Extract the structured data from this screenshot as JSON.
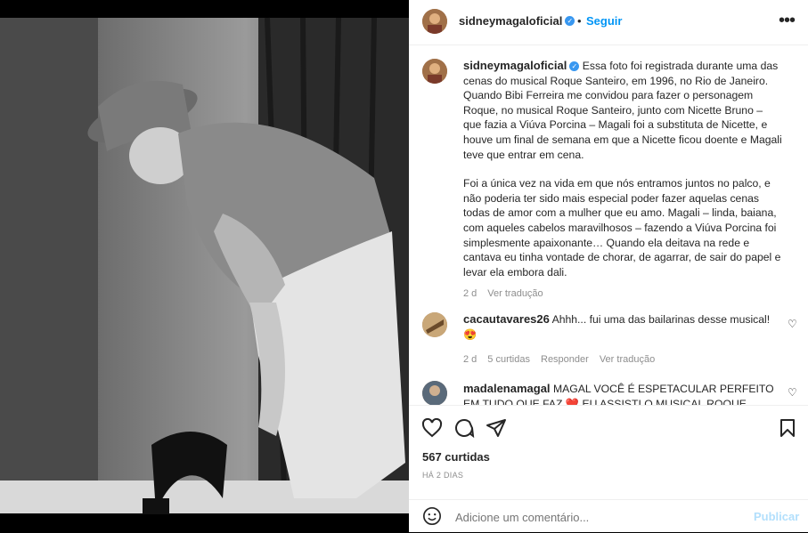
{
  "post": {
    "username": "sidneymagaloficial",
    "follow_label": "Seguir",
    "separator": "•"
  },
  "caption": {
    "username": "sidneymagaloficial",
    "paragraph1": "Essa foto foi registrada durante uma das cenas do musical Roque Santeiro, em 1996, no Rio de Janeiro. Quando Bibi Ferreira me convidou para fazer o personagem Roque, no musical Roque Santeiro, junto com Nicette Bruno – que fazia a Viúva Porcina – Magali foi a substituta de Nicette, e houve um final de semana em que a Nicette ficou doente e Magali teve que entrar em cena.",
    "paragraph2": "Foi a única vez na vida em que nós entramos juntos no palco, e não poderia ter sido mais especial poder fazer aquelas cenas todas de amor com a mulher que eu amo. Magali – linda, baiana, com aqueles cabelos maravilhosos – fazendo a Viúva Porcina foi simplesmente apaixonante… Quando ela deitava na rede e cantava eu tinha vontade de chorar, de agarrar, de sair do papel e levar ela embora dali.",
    "time": "2 d",
    "translate": "Ver tradução"
  },
  "comments": [
    {
      "username": "cacautavares26",
      "text": "Ahhh... fui uma das bailarinas desse musical! 😍",
      "time": "2 d",
      "likes": "5 curtidas",
      "reply": "Responder",
      "translate": "Ver tradução"
    },
    {
      "username": "madalenamagal",
      "text": "MAGAL VOCÊ É ESPETACULAR PERFEITO EM TUDO QUE FAZ ❤️ EU ASSISTI O MUSICAL ROQUE"
    }
  ],
  "stats": {
    "likes": "567 curtidas",
    "date": "HÁ 2 DIAS"
  },
  "composer": {
    "placeholder": "Adicione um comentário...",
    "publish": "Publicar"
  },
  "colors": {
    "link": "#0095f6",
    "verified": "#3897f0",
    "secondary_text": "#8e8e8e",
    "divider": "#efefef"
  },
  "icons": [
    "verified-icon",
    "more-icon",
    "heart-icon",
    "comment-icon",
    "share-icon",
    "bookmark-icon",
    "emoji-icon"
  ]
}
